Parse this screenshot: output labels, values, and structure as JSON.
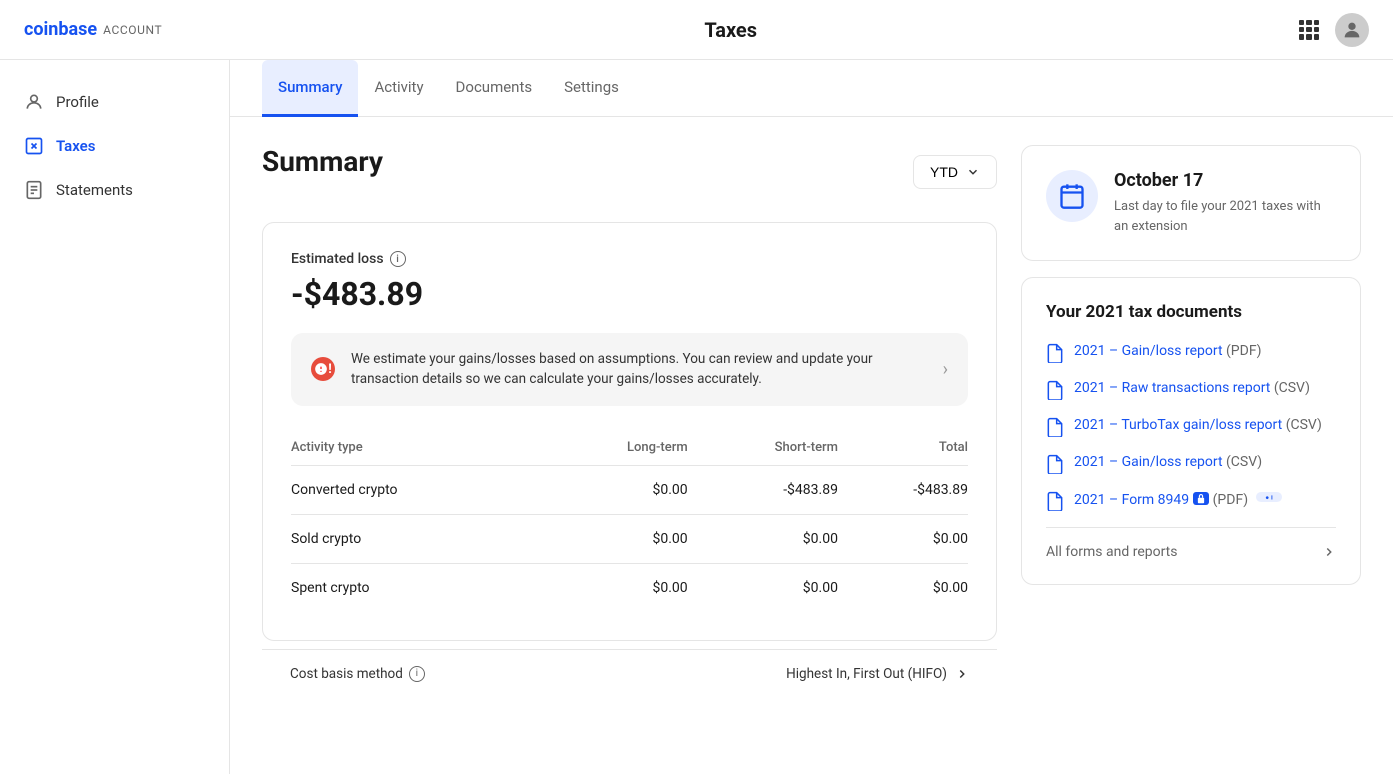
{
  "app": {
    "logo_brand": "coinbase",
    "logo_account": "ACCOUNT",
    "page_title": "Taxes"
  },
  "sidebar": {
    "items": [
      {
        "id": "profile",
        "label": "Profile",
        "active": false
      },
      {
        "id": "taxes",
        "label": "Taxes",
        "active": true
      },
      {
        "id": "statements",
        "label": "Statements",
        "active": false
      }
    ]
  },
  "tabs": [
    {
      "id": "summary",
      "label": "Summary",
      "active": true
    },
    {
      "id": "activity",
      "label": "Activity",
      "active": false
    },
    {
      "id": "documents",
      "label": "Documents",
      "active": false
    },
    {
      "id": "settings",
      "label": "Settings",
      "active": false
    }
  ],
  "summary": {
    "page_title": "Summary",
    "ytd_label": "YTD",
    "estimated_loss_label": "Estimated loss",
    "loss_amount": "-$483.89",
    "warning_text": "We estimate your gains/losses based on assumptions. You can review and update your transaction details so we can calculate your gains/losses accurately.",
    "table": {
      "headers": [
        "Activity type",
        "Long-term",
        "Short-term",
        "Total"
      ],
      "rows": [
        {
          "type": "Converted crypto",
          "long_term": "$0.00",
          "short_term": "-$483.89",
          "total": "-$483.89"
        },
        {
          "type": "Sold crypto",
          "long_term": "$0.00",
          "short_term": "$0.00",
          "total": "$0.00"
        },
        {
          "type": "Spent crypto",
          "long_term": "$0.00",
          "short_term": "$0.00",
          "total": "$0.00"
        }
      ]
    },
    "cost_basis_label": "Cost basis method",
    "cost_basis_value": "Highest In, First Out (HIFO)"
  },
  "right_panel": {
    "date_card": {
      "title": "October 17",
      "description": "Last day to file your 2021 taxes with an extension"
    },
    "tax_docs": {
      "title": "Your 2021 tax documents",
      "docs": [
        {
          "id": "gain-loss-pdf",
          "link_text": "2021 – Gain/loss report",
          "suffix": "(PDF)",
          "locked": false
        },
        {
          "id": "raw-transactions",
          "link_text": "2021 – Raw transactions report",
          "suffix": "(CSV)",
          "locked": false
        },
        {
          "id": "turbotax",
          "link_text": "2021 – TurboTax gain/loss report",
          "suffix": "(CSV)",
          "locked": false
        },
        {
          "id": "gain-loss-csv",
          "link_text": "2021 – Gain/loss report",
          "suffix": "(CSV)",
          "locked": false
        },
        {
          "id": "form-8949",
          "link_text": "2021 – Form 8949",
          "suffix": "(PDF)",
          "locked": true
        }
      ],
      "all_reports_label": "All forms and reports"
    }
  }
}
